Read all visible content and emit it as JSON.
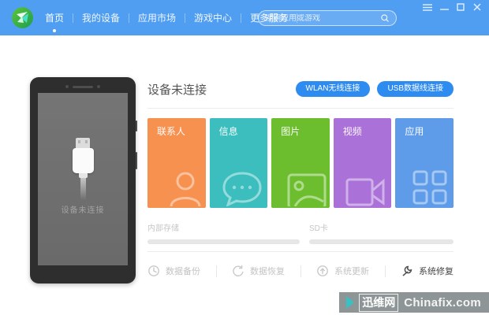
{
  "window": {
    "controls": [
      {
        "name": "menu"
      },
      {
        "name": "minimize"
      },
      {
        "name": "maximize"
      },
      {
        "name": "close"
      }
    ]
  },
  "header": {
    "logo": "green-bird-logo",
    "nav": {
      "items": [
        {
          "label": "首页",
          "active": true
        },
        {
          "label": "我的设备",
          "active": false
        },
        {
          "label": "应用市场",
          "active": false
        },
        {
          "label": "游戏中心",
          "active": false
        },
        {
          "label": "更多服务",
          "active": false
        }
      ]
    },
    "search": {
      "placeholder": "搜索应用或游戏",
      "value": "",
      "icon": "search-icon"
    }
  },
  "phone": {
    "screen_text": "设备未连接",
    "graphic": "usb-cable"
  },
  "main": {
    "title": "设备未连接",
    "connect_buttons": [
      {
        "label": "WLAN无线连接"
      },
      {
        "label": "USB数据线连接"
      }
    ],
    "tiles": [
      {
        "label": "联系人",
        "color": "#F79150",
        "icon": "contact-icon"
      },
      {
        "label": "信息",
        "color": "#3CBEBE",
        "icon": "message-icon"
      },
      {
        "label": "图片",
        "color": "#6CBE2E",
        "icon": "picture-icon"
      },
      {
        "label": "视频",
        "color": "#AA71D9",
        "icon": "video-icon"
      },
      {
        "label": "应用",
        "color": "#5E9CE9",
        "icon": "apps-grid-icon"
      }
    ],
    "storage": [
      {
        "label": "内部存储",
        "state": "empty"
      },
      {
        "label": "SD卡",
        "state": "empty"
      }
    ],
    "actions": [
      {
        "label": "数据备份",
        "icon": "clock-icon",
        "enabled": false
      },
      {
        "label": "数据恢复",
        "icon": "restore-icon",
        "enabled": false
      },
      {
        "label": "系统更新",
        "icon": "update-icon",
        "enabled": false
      },
      {
        "label": "系统修复",
        "icon": "wrench-icon",
        "enabled": true
      }
    ]
  },
  "watermark": {
    "site_cn": "迅维网",
    "site_en": "Chinafix.com",
    "chevron_color": "#35C2C4"
  },
  "colors": {
    "header_blue": "#4F9EF1",
    "button_blue": "#2E8BF0",
    "content_bg": "#FFFFFF",
    "phone_frame": "#2E2E2E",
    "phone_screen": "#707070"
  }
}
